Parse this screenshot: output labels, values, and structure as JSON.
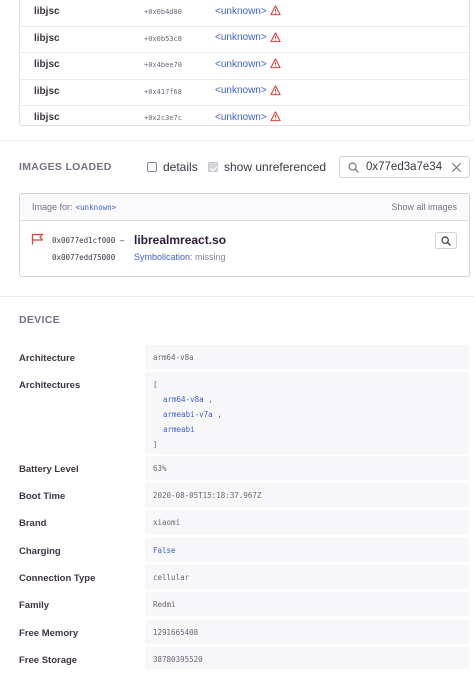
{
  "frames": [
    {
      "package": "libjsc",
      "address": "+0x0b4d80",
      "function": "<unknown>"
    },
    {
      "package": "libjsc",
      "address": "+0x0b53c8",
      "function": "<unknown>"
    },
    {
      "package": "libjsc",
      "address": "+0x4bee70",
      "function": "<unknown>"
    },
    {
      "package": "libjsc",
      "address": "+0x417f68",
      "function": "<unknown>"
    },
    {
      "package": "libjsc",
      "address": "+0x2c3e7c",
      "function": "<unknown>"
    }
  ],
  "images_loaded": {
    "title": "IMAGES LOADED",
    "details_label": "details",
    "show_unreferenced_label": "show unreferenced",
    "search_value": "0x77ed3a7e34",
    "image_for_label": "Image for:",
    "image_for_value": "<unknown>",
    "show_all_label": "Show all images",
    "image": {
      "addr_start": "0x0077ed1cf000 –",
      "addr_end": "0x0077edd75000",
      "name": "librealmreact.so",
      "symbolication_label": "Symbolication",
      "symbolication_value": ": missing"
    }
  },
  "device": {
    "title": "DEVICE",
    "architecture_key": "Architecture",
    "architecture_val": "arm64-v8a",
    "architectures_key": "Architectures",
    "arch_open": "[",
    "arch_items": [
      "arm64-v8a",
      "armeabi-v7a",
      "armeabi"
    ],
    "arch_comma": ",",
    "arch_close": "]",
    "battery_key": "Battery Level",
    "battery_val": "63%",
    "boot_key": "Boot Time",
    "boot_val": "2020-08-05T15:18:37.967Z",
    "brand_key": "Brand",
    "brand_val": "xiaomi",
    "charging_key": "Charging",
    "charging_val": "False",
    "conn_key": "Connection Type",
    "conn_val": "cellular",
    "family_key": "Family",
    "family_val": "Redmi",
    "freemem_key": "Free Memory",
    "freemem_val": "1291665408",
    "freestor_key": "Free Storage",
    "freestor_val": "38780395520"
  },
  "colors": {
    "accent": "#3d5fd0",
    "warning": "#e0403a",
    "muted": "#7a6e85"
  }
}
